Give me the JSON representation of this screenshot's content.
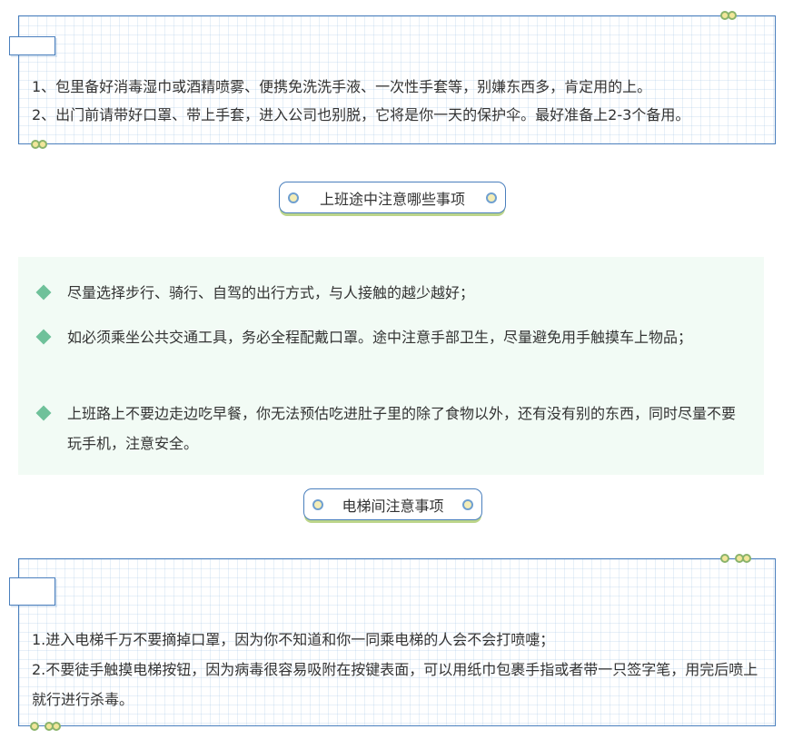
{
  "top_box": {
    "lines": [
      "1、包里备好消毒湿巾或酒精喷雾、便携免洗洗手液、一次性手套等，别嫌东西多，肯定用的上。",
      "2、出门前请带好口罩、带上手套，进入公司也别脱，它将是你一天的保护伞。最好准备上2-3个备用。"
    ]
  },
  "commute_header": "上班途中注意哪些事项",
  "commute_tips": [
    "尽量选择步行、骑行、自驾的出行方式，与人接触的越少越好；",
    "如必须乘坐公共交通工具，务必全程配戴口罩。途中注意手部卫生，尽量避免用手触摸车上物品；",
    "上班路上不要边走边吃早餐，你无法预估吃进肚子里的除了食物以外，还有没有别的东西，同时尽量不要玩手机，注意安全。"
  ],
  "elevator_header": "电梯间注意事项",
  "bottom_box": {
    "lines": [
      "1.进入电梯千万不要摘掉口罩，因为你不知道和你一同乘电梯的人会不会打喷嚏；",
      "2.不要徒手触摸电梯按钮，因为病毒很容易吸附在按键表面，可以用纸巾包裹手指或者带一只签字笔，用完后喷上就行进行杀毒。"
    ]
  },
  "colors": {
    "border": "#4a7fbd",
    "panel_bg": "#f2fbf5",
    "bullet": "#6fc19a",
    "dot_fill": "#f2e69a",
    "dot_ring": "#8ab36b"
  },
  "icons": {
    "bullet": "diamond-bullet-icon",
    "header_ring": "ring-dot-icon",
    "corner_dots": "double-dot-icon"
  }
}
